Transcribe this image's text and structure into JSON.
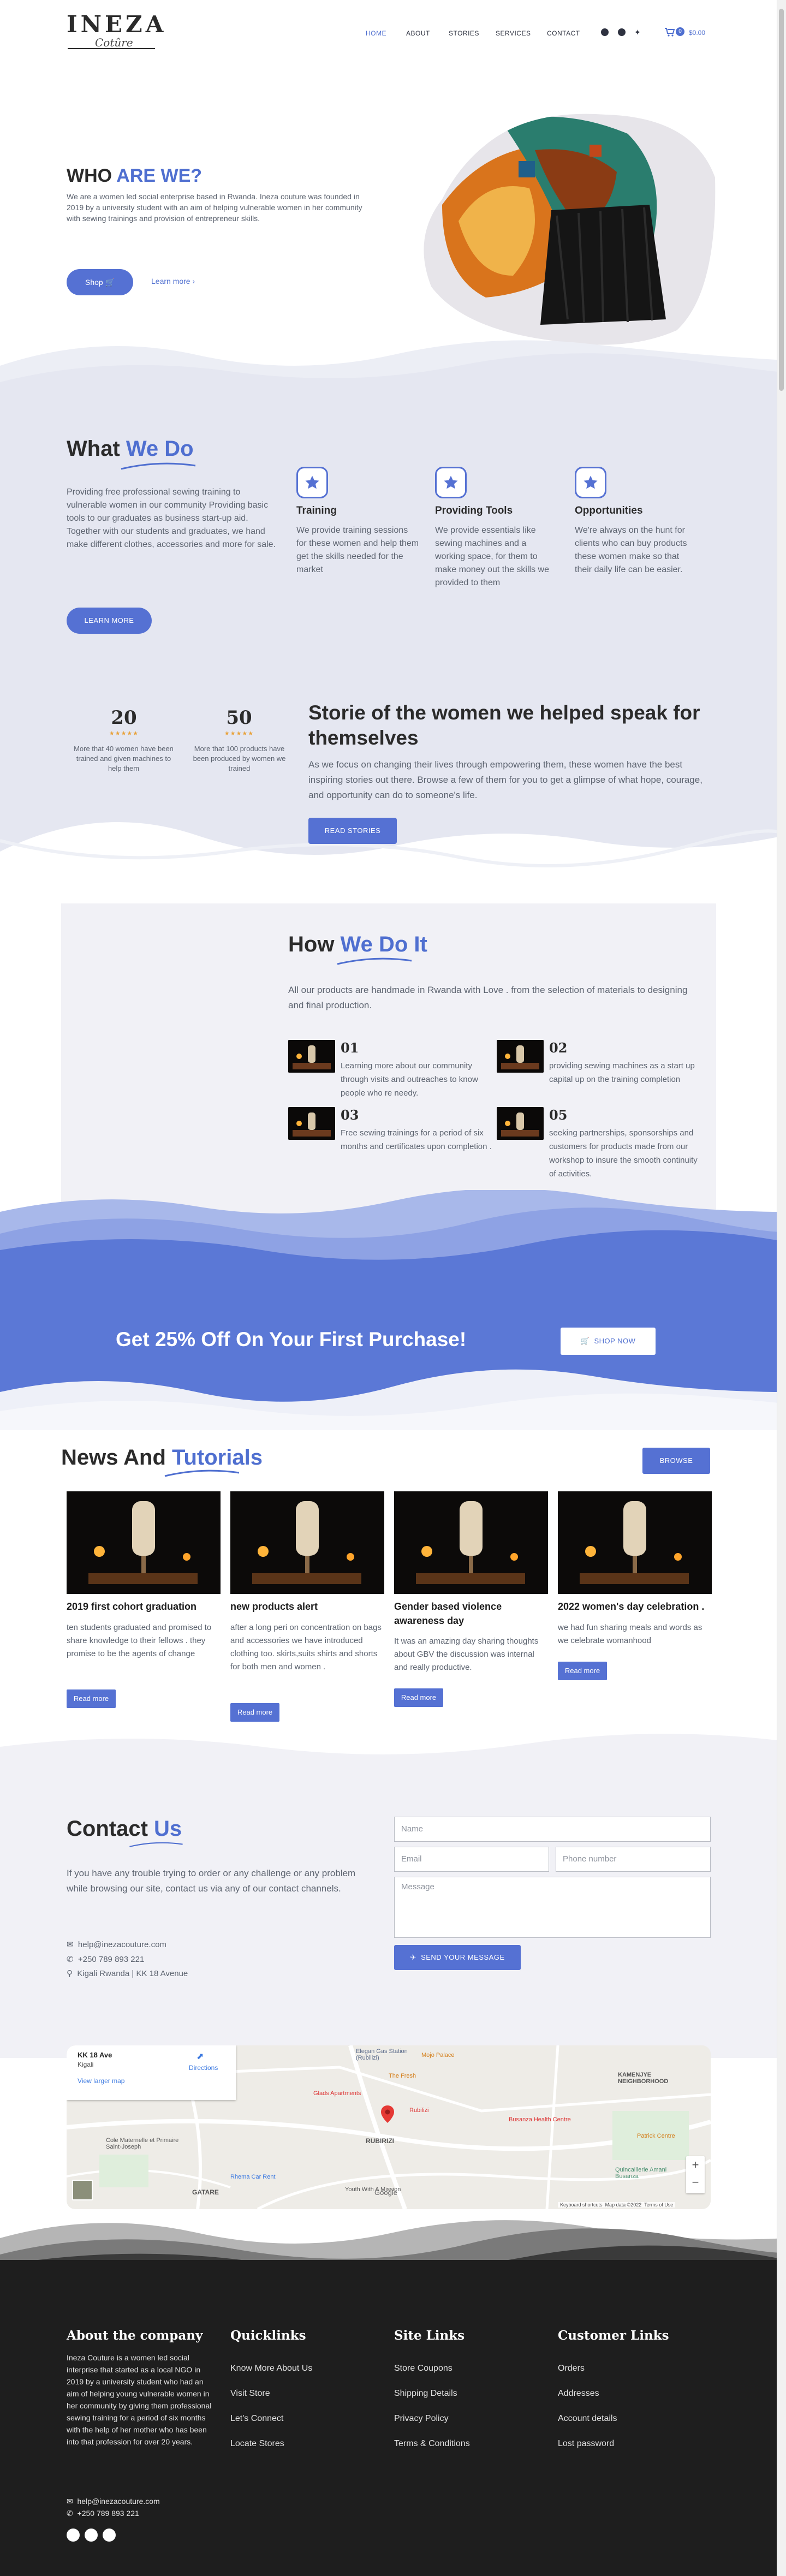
{
  "header": {
    "logo_main": "INEZA",
    "logo_sub": "Cotûre",
    "nav": [
      "HOME",
      "ABOUT",
      "STORIES",
      "SERVICES",
      "CONTACT"
    ],
    "cart_count": "0",
    "cart_total": "$0.00"
  },
  "hero": {
    "title_a": "WHO ",
    "title_b": "ARE WE?",
    "text": "We are a women led social enterprise based in Rwanda. Ineza couture was founded in 2019 by a university student with an aim of helping vulnerable women in her community with  sewing trainings and provision of entrepreneur skills.",
    "shop_label": "Shop",
    "learn_label": "Learn more"
  },
  "what_we_do": {
    "title_a": "What ",
    "title_b": "We Do",
    "text": "Providing free professional sewing training to vulnerable women in our community Providing basic tools to our graduates as business start-up aid. Together with our students and graduates, we hand make different clothes, accessories and more for sale.",
    "button": "LEARN MORE",
    "features": [
      {
        "title": "Training",
        "text": "We provide training sessions for these women and help them get the skills needed for the market"
      },
      {
        "title": "Providing Tools",
        "text": "We provide essentials like sewing machines and a working space, for them to make money out the skills we provided to them"
      },
      {
        "title": "Opportunities",
        "text": "We're always on the hunt for clients who can buy products these women make so that their daily life can be easier."
      }
    ]
  },
  "stats": [
    {
      "num": "20",
      "text": "More that 40 women have been trained and given machines to help them"
    },
    {
      "num": "50",
      "text": "More that 100 products have been produced by women we trained"
    }
  ],
  "stories": {
    "title": "Storie of the women we helped speak for themselves",
    "text": "As we focus on changing their lives through empowering them, these women have the best inspiring stories out there. Browse a few of them for you to get a glimpse of what hope, courage, and opportunity can do to someone's life.",
    "button": "READ STORIES"
  },
  "how": {
    "title_a": "How ",
    "title_b": "We Do It",
    "text": "All our products are handmade in Rwanda with Love . from the selection of materials to designing and final production.",
    "steps": [
      {
        "num": "01",
        "text": "Learning more about our community through visits and outreaches to know people who re needy."
      },
      {
        "num": "02",
        "text": "providing sewing machines as a start up capital up on the training completion"
      },
      {
        "num": "03",
        "text": "Free sewing trainings for a period of six months and certificates upon completion ."
      },
      {
        "num": "05",
        "text": "seeking partnerships, sponsorships and customers for products made from our workshop to insure the smooth continuity of activities."
      }
    ]
  },
  "promo": {
    "text": "Get 25% Off On Your First Purchase!",
    "button": "SHOP NOW"
  },
  "news": {
    "title_a": "News And ",
    "title_b": "Tutorials",
    "browse": "BROWSE",
    "read_more": "Read more",
    "cards": [
      {
        "title": "2019 first cohort graduation",
        "text": "ten students graduated and promised to share knowledge to their fellows . they promise to be the agents of change"
      },
      {
        "title": "new products alert",
        "text": "after a long peri on concentration on bags and accessories we have introduced clothing too. skirts,suits shirts and shorts for both men and women ."
      },
      {
        "title": "Gender based violence awareness day",
        "text": "It was an amazing day sharing thoughts about GBV the discussion was internal and really productive."
      },
      {
        "title": "2022 women's day celebration .",
        "text": "we had fun sharing meals and words as we celebrate womanhood"
      }
    ]
  },
  "contact": {
    "title_a": "Contact ",
    "title_b": "Us",
    "text": "If you have any trouble trying to order or any challenge or any problem while browsing our site, contact us via any of our contact channels.",
    "email": "help@inezacouture.com",
    "phone": "+250 789 893 221",
    "address": "Kigali Rwanda | KK 18 Avenue",
    "placeholders": {
      "name": "Name",
      "email": "Email",
      "phone": "Phone number",
      "message": "Message"
    },
    "button": "SEND YOUR MESSAGE"
  },
  "map": {
    "place_title": "KK 18 Ave",
    "place_sub": "Kigali",
    "directions": "Directions",
    "larger": "View larger map",
    "labels": [
      "Elegan Gas Station (Rubilizi)",
      "Mojo Palace",
      "The Fresh",
      "Glads Apartments",
      "Rubilizi",
      "Busanza Health Centre",
      "KAMENJYE NEIGHBORHOOD",
      "Patrick Centre",
      "Cole Maternelle et Primaire Saint-Joseph",
      "Quincaillerie Amani Busanza",
      "Rhema Car Rent",
      "GATARE",
      "RUBIRIZI",
      "Youth With A Mission"
    ],
    "footer_texts": [
      "Keyboard shortcuts",
      "Map data ©2022",
      "Terms of Use"
    ]
  },
  "footer": {
    "about_head": "About the company",
    "about_text": "Ineza Couture is a women led social interprise that started as a local NGO in 2019 by a university student who had an aim of helping young vulnerable women in her community by giving them professional sewing training for a period of six months with the help of her mother who has been into that profession for over 20 years.",
    "email": "help@inezacouture.com",
    "phone": "+250 789 893 221",
    "cols": [
      {
        "head": "Quicklinks",
        "links": [
          "Know More About Us",
          "Visit Store",
          "Let's Connect",
          "Locate Stores"
        ]
      },
      {
        "head": "Site Links",
        "links": [
          "Store Coupons",
          "Shipping Details",
          "Privacy Policy",
          "Terms & Conditions"
        ]
      },
      {
        "head": "Customer Links",
        "links": [
          "Orders",
          "Addresses",
          "Account details",
          "Lost password"
        ]
      }
    ]
  },
  "colors": {
    "accent": "#5571d3",
    "dark": "#2b2b2b",
    "footer": "#1e1e1e",
    "section_bg": "#f1f1f6"
  }
}
